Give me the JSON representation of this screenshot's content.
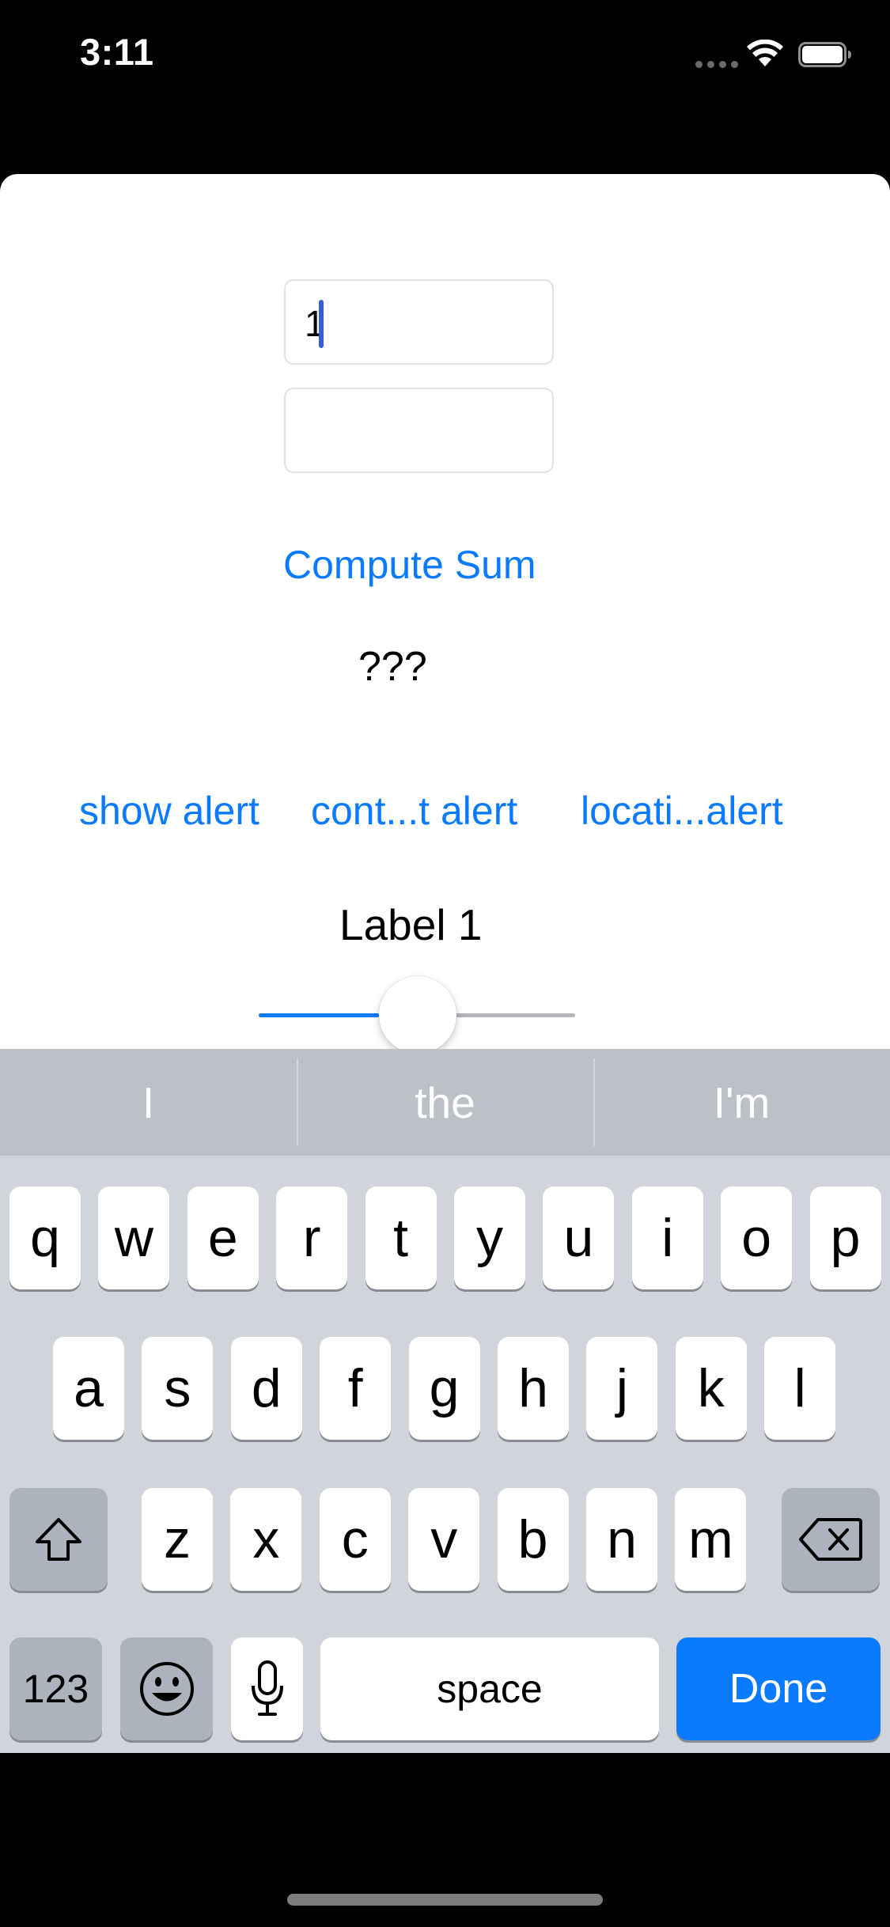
{
  "status_bar": {
    "time": "3:11"
  },
  "form": {
    "field1_value": "1",
    "field2_value": "",
    "compute_label": "Compute Sum",
    "result_text": "???"
  },
  "alerts": {
    "show_label": "show alert",
    "contacts_label": "cont...t alert",
    "location_label": "locati...alert"
  },
  "label1": "Label 1",
  "slider": {
    "value_fraction": 0.38
  },
  "keyboard": {
    "suggestions": [
      "I",
      "the",
      "I'm"
    ],
    "row1": [
      "q",
      "w",
      "e",
      "r",
      "t",
      "y",
      "u",
      "i",
      "o",
      "p"
    ],
    "row2": [
      "a",
      "s",
      "d",
      "f",
      "g",
      "h",
      "j",
      "k",
      "l"
    ],
    "row3": [
      "z",
      "x",
      "c",
      "v",
      "b",
      "n",
      "m"
    ],
    "numbers_label": "123",
    "space_label": "space",
    "done_label": "Done"
  },
  "colors": {
    "accent": "#0a7aff",
    "caret": "#3c5bdb",
    "keyboard_bg": "#d1d4da"
  }
}
